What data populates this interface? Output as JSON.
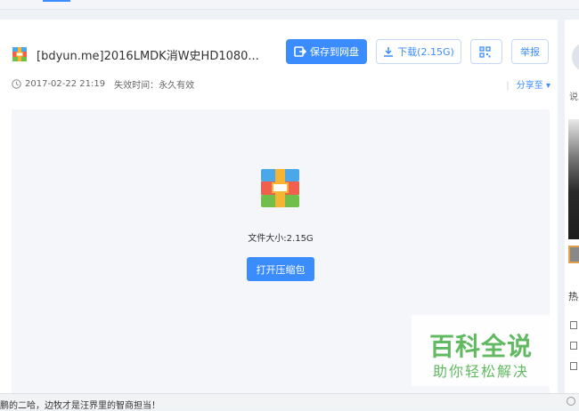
{
  "file": {
    "title": "[bdyun.me]2016LMDK消W史HD1080...",
    "date": "2017-02-22 21:19",
    "expiry": "失效时间：永久有效",
    "share_label": "分享至"
  },
  "toolbar": {
    "save_label": "保存到网盘",
    "download_label": "下载(2.15G)",
    "report_label": "举报"
  },
  "preview": {
    "size_text": "文件大小:2.15G",
    "open_label": "打开压缩包"
  },
  "sidebar": {
    "text1": "说",
    "hot_label": "热"
  },
  "watermark": {
    "title": "百科全说",
    "subtitle": "助你轻松解决"
  },
  "footer": {
    "text": "結鹏的二哈，边牧才是汪界里的智商担当！"
  },
  "colors": {
    "accent": "#3b8cff",
    "watermark": "#5cb85c"
  }
}
